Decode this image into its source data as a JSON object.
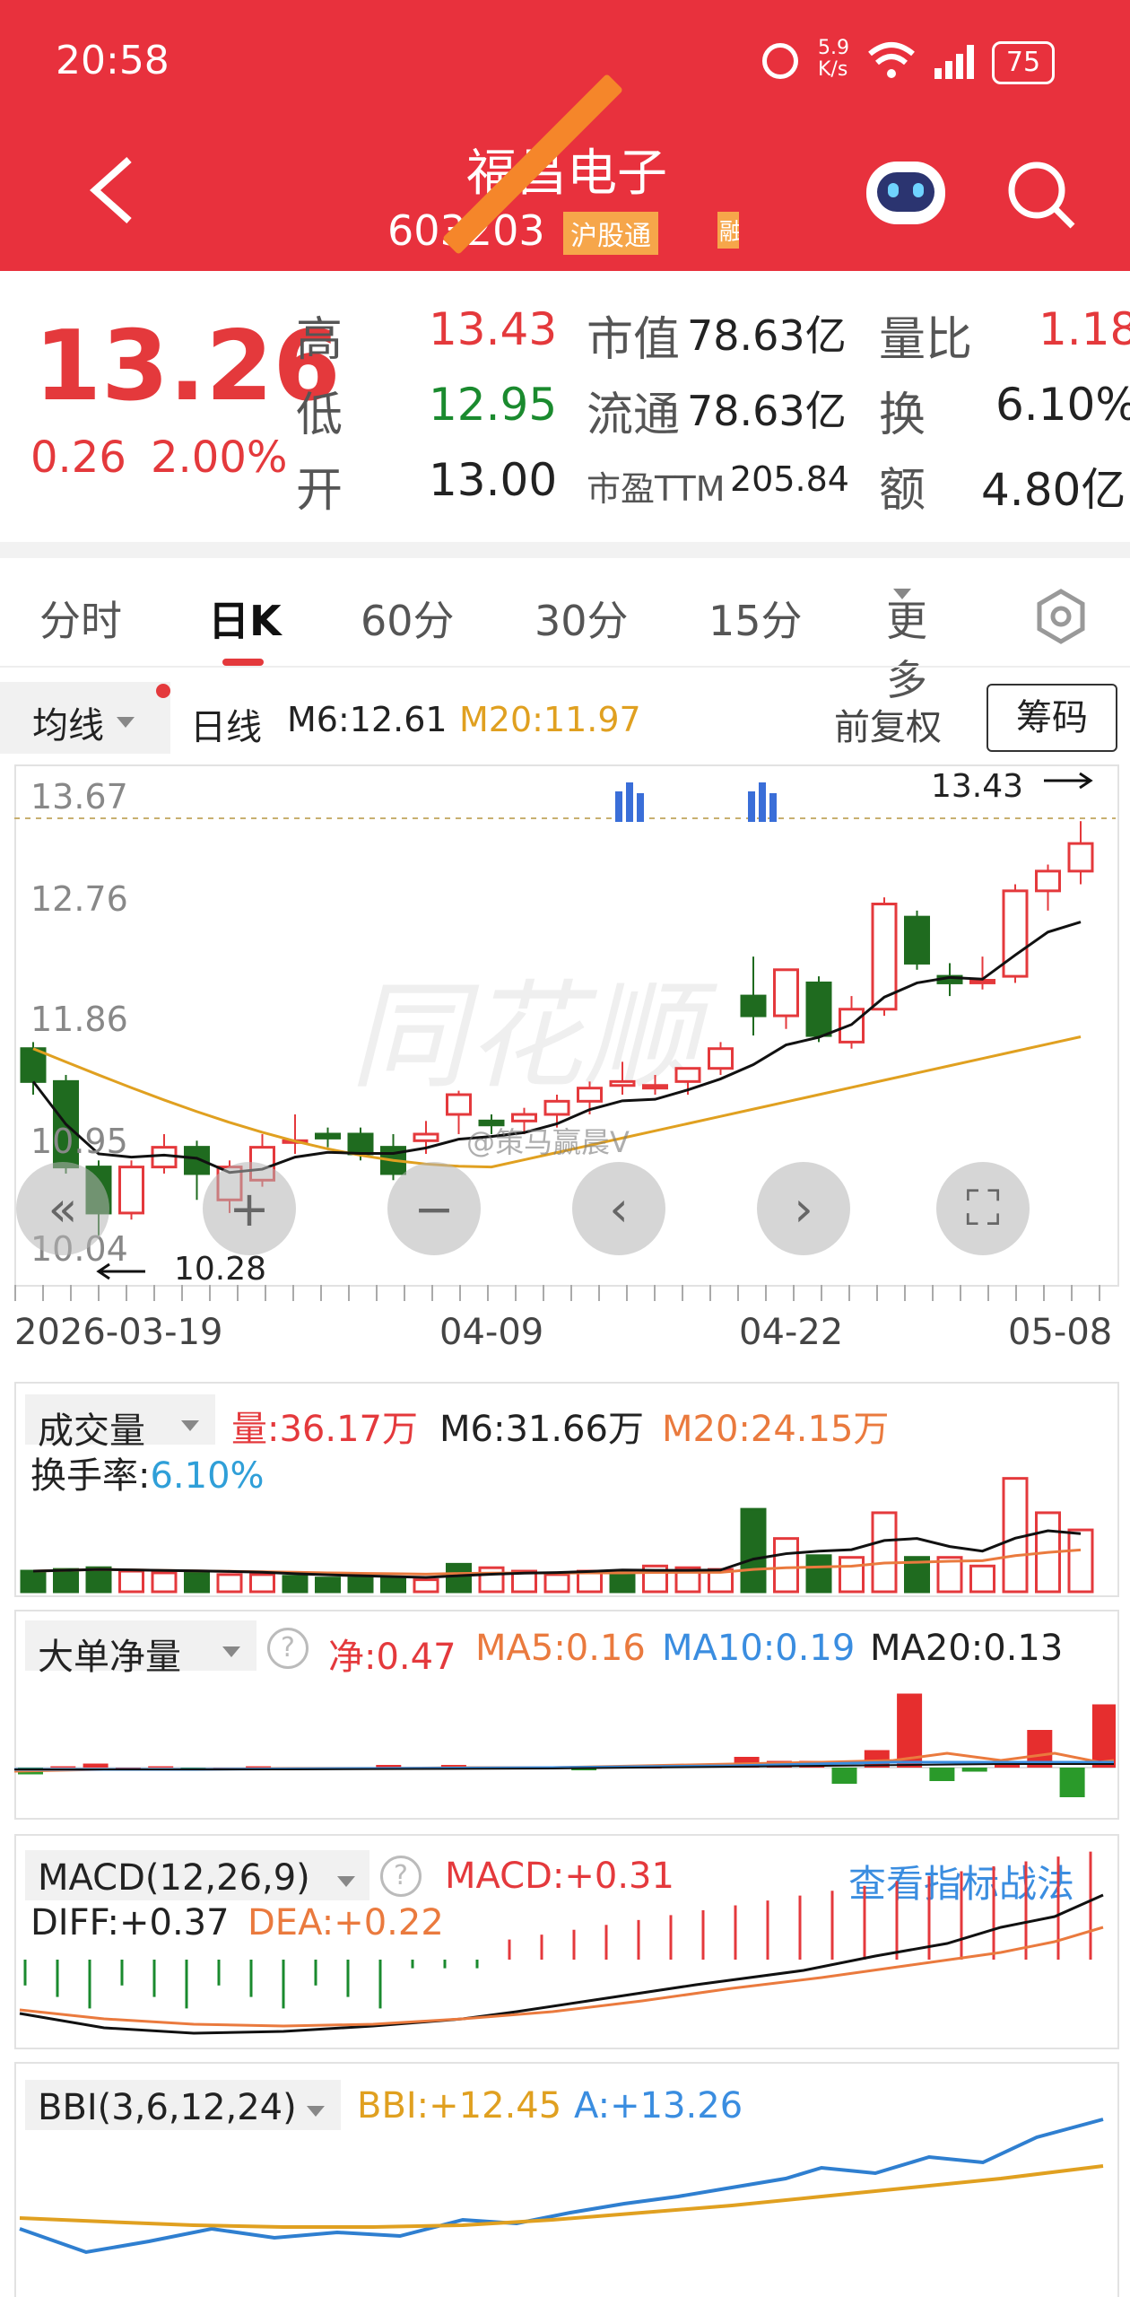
{
  "status_bar": {
    "time": "20:58",
    "net_speed_top": "5.9",
    "net_speed_bottom": "K/s",
    "battery": "75"
  },
  "header": {
    "title": "福昌电子",
    "code": "603203",
    "tag": "沪股通",
    "tag2": "融"
  },
  "quote": {
    "price": "13.26",
    "change": "0.26",
    "change_pct": "2.00%",
    "rows": [
      {
        "l1": "高",
        "v1": "13.43",
        "l2": "市值",
        "v2": "78.63亿",
        "l3": "量比",
        "v3": "1.18"
      },
      {
        "l1": "低",
        "v1": "12.95",
        "l2": "流通",
        "v2": "78.63亿",
        "l3": "换",
        "v3": "6.10%"
      },
      {
        "l1": "开",
        "v1": "13.00",
        "l2": "市盈TTM",
        "v2": "205.84",
        "l3": "额",
        "v3": "4.80亿"
      }
    ]
  },
  "tabs": {
    "items": [
      "分时",
      "日K",
      "60分",
      "30分",
      "15分",
      "更多"
    ],
    "active": "日K"
  },
  "kline_bar": {
    "ma_select": "均线",
    "period": "日线",
    "m6": "M6:12.61",
    "m20": "M20:11.97",
    "adjust": "前复权",
    "chips": "筹码"
  },
  "kline": {
    "y_labels": [
      "13.67",
      "12.76",
      "11.86",
      "10.95",
      "10.04"
    ],
    "high_label": "13.43",
    "low_label": "10.28",
    "watermark": "同花顺",
    "weibo": "@策马赢晨V",
    "x_labels": [
      "2026-03-19",
      "04-09",
      "04-22",
      "05-08"
    ],
    "controls": [
      "rewind",
      "zoom-in",
      "zoom-out",
      "prev",
      "next",
      "fullscreen"
    ]
  },
  "volume": {
    "title": "成交量",
    "vol": "量:36.17万",
    "m6": "M6:31.66万",
    "m20": "M20:24.15万",
    "turnover_label": "换手率:",
    "turnover": "6.10%"
  },
  "bigorder": {
    "title": "大单净量",
    "net": "净:0.47",
    "ma5": "MA5:0.16",
    "ma10": "MA10:0.19",
    "ma20": "MA20:0.13"
  },
  "macd": {
    "title": "MACD(12,26,9)",
    "macd": "MACD:+0.31",
    "link": "查看指标战法",
    "diff": "DIFF:+0.37",
    "dea": "DEA:+0.22"
  },
  "bbi": {
    "title": "BBI(3,6,12,24)",
    "bbi": "BBI:+12.45",
    "a": "A:+13.26"
  },
  "colors": {
    "header": "#e8313d",
    "up": "#e4393c",
    "down": "#1f6b1f",
    "ma20": "#e0a020"
  },
  "chart_data": [
    {
      "type": "candlestick",
      "title": "日线",
      "ylim": [
        10.04,
        13.67
      ],
      "y_ticks": [
        13.67,
        12.76,
        11.86,
        10.95,
        10.04
      ],
      "x_ticks": [
        "2026-03-19",
        "04-09",
        "04-22",
        "05-08"
      ],
      "ohlc": [
        [
          11.7,
          11.75,
          11.35,
          11.45
        ],
        [
          11.45,
          11.5,
          10.75,
          10.8
        ],
        [
          10.8,
          10.85,
          10.28,
          10.45
        ],
        [
          10.45,
          10.85,
          10.4,
          10.8
        ],
        [
          10.8,
          11.05,
          10.75,
          10.95
        ],
        [
          10.95,
          11.0,
          10.55,
          10.75
        ],
        [
          10.55,
          10.85,
          10.45,
          10.8
        ],
        [
          10.7,
          11.05,
          10.65,
          10.95
        ],
        [
          11.0,
          11.2,
          10.9,
          11.0
        ],
        [
          11.05,
          11.1,
          10.95,
          11.02
        ],
        [
          11.05,
          11.1,
          10.85,
          10.9
        ],
        [
          10.95,
          11.05,
          10.7,
          10.75
        ],
        [
          11.0,
          11.15,
          10.9,
          11.05
        ],
        [
          11.2,
          11.38,
          11.05,
          11.35
        ],
        [
          11.15,
          11.2,
          11.05,
          11.12
        ],
        [
          11.15,
          11.25,
          11.05,
          11.2
        ],
        [
          11.2,
          11.35,
          11.1,
          11.3
        ],
        [
          11.3,
          11.45,
          11.2,
          11.4
        ],
        [
          11.42,
          11.6,
          11.35,
          11.45
        ],
        [
          11.4,
          11.5,
          11.35,
          11.42
        ],
        [
          11.45,
          11.55,
          11.35,
          11.55
        ],
        [
          11.55,
          11.75,
          11.5,
          11.7
        ],
        [
          12.1,
          12.4,
          11.8,
          11.95
        ],
        [
          11.95,
          12.3,
          11.85,
          12.3
        ],
        [
          12.2,
          12.25,
          11.75,
          11.8
        ],
        [
          11.75,
          12.1,
          11.7,
          12.0
        ],
        [
          12.0,
          12.85,
          11.95,
          12.8
        ],
        [
          12.7,
          12.75,
          12.3,
          12.35
        ],
        [
          12.25,
          12.35,
          12.1,
          12.2
        ],
        [
          12.2,
          12.4,
          12.15,
          12.22
        ],
        [
          12.25,
          12.95,
          12.2,
          12.9
        ],
        [
          12.9,
          13.1,
          12.75,
          13.05
        ],
        [
          13.05,
          13.43,
          12.95,
          13.26
        ]
      ],
      "ma6_label": "M6:12.61",
      "ma20_label": "M20:11.97"
    },
    {
      "type": "bar",
      "title": "成交量",
      "values": [
        12,
        13,
        14,
        12,
        11,
        11,
        10,
        10,
        9,
        8,
        8,
        8,
        7,
        16,
        14,
        12,
        10,
        12,
        12,
        15,
        14,
        13,
        48,
        31,
        21,
        20,
        46,
        20,
        20,
        15,
        66,
        46,
        36
      ],
      "up": [
        0,
        0,
        0,
        1,
        1,
        0,
        1,
        1,
        0,
        0,
        0,
        0,
        1,
        0,
        1,
        1,
        1,
        1,
        0,
        1,
        1,
        1,
        0,
        1,
        0,
        1,
        1,
        0,
        1,
        1,
        1,
        1,
        1
      ]
    },
    {
      "type": "bar",
      "title": "大单净量",
      "values": [
        -0.05,
        0.01,
        0.03,
        0.0,
        0.01,
        -0.02,
        0.0,
        0.01,
        0.0,
        -0.01,
        0.0,
        0.02,
        -0.01,
        0.02,
        0.01,
        0.01,
        0.01,
        -0.02,
        0.0,
        0.0,
        0.02,
        0.03,
        0.08,
        0.05,
        0.05,
        -0.12,
        0.13,
        0.55,
        -0.1,
        -0.03,
        0.02,
        0.28,
        -0.22,
        0.47
      ]
    }
  ]
}
